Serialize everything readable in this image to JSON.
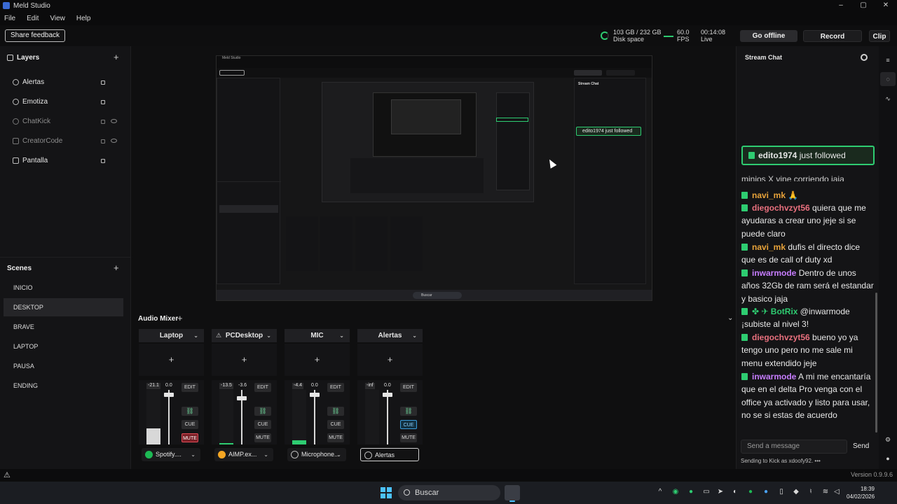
{
  "window": {
    "title": "Meld Studio",
    "controls": [
      "–",
      "▢",
      "✕"
    ]
  },
  "menu": [
    "File",
    "Edit",
    "View",
    "Help"
  ],
  "toolbar": {
    "feedback_label": "Share feedback",
    "disk_value": "103 GB / 232 GB",
    "disk_label": "Disk space",
    "fps_value": "60.0",
    "fps_label": "FPS",
    "live_time": "00:14:08",
    "live_label": "Live",
    "go_offline": "Go offline",
    "record": "Record",
    "clip": "Clip"
  },
  "layers": {
    "title": "Layers",
    "items": [
      {
        "label": "Alertas",
        "dim": false
      },
      {
        "label": "Emotiza",
        "dim": false
      },
      {
        "label": "ChatKick",
        "dim": true
      },
      {
        "label": "CreatorCode",
        "dim": true
      },
      {
        "label": "Pantalla",
        "dim": false
      }
    ]
  },
  "scenes": {
    "title": "Scenes",
    "items": [
      "INICIO",
      "DESKTOP",
      "BRAVE",
      "LAPTOP",
      "PAUSA",
      "ENDING"
    ],
    "active": "DESKTOP"
  },
  "mixer": {
    "title": "Audio Mixer",
    "channels": [
      {
        "name": "Laptop",
        "meter_db": "-21.1",
        "fader_db": "0.0",
        "level": 0.3,
        "fader": 0.95,
        "muted": true,
        "cue": false,
        "source": "Spotify....",
        "source_color": "#1db954",
        "warn": false,
        "meter_color": "#d8d8d8"
      },
      {
        "name": "PCDesktop",
        "meter_db": "-13.5",
        "fader_db": "-3.6",
        "level": 0.02,
        "fader": 0.88,
        "muted": false,
        "cue": false,
        "source": "AIMP.ex...",
        "source_color": "#f5a623",
        "warn": true,
        "meter_color": "#2ecc71"
      },
      {
        "name": "MIC",
        "meter_db": "-4.4",
        "fader_db": "0.0",
        "level": 0.08,
        "fader": 0.95,
        "muted": false,
        "cue": false,
        "source": "Microphone...",
        "source_color": "",
        "warn": false,
        "meter_color": "#2ecc71"
      },
      {
        "name": "Alertas",
        "meter_db": "-inf",
        "fader_db": "0.0",
        "level": 0.0,
        "fader": 0.95,
        "muted": false,
        "cue": true,
        "source": "Alertas",
        "source_color": "",
        "warn": false,
        "meter_color": "#2ecc71"
      }
    ],
    "btn_edit": "EDIT",
    "btn_cue": "CUE",
    "btn_mute": "MUTE"
  },
  "chat": {
    "title": "Stream Chat",
    "follow": {
      "user": "edito1974",
      "text": "just followed"
    },
    "partial_top": "minios X vine corriendo jaja",
    "messages": [
      {
        "user": "navi_mk",
        "color": "#e8a33a",
        "text": "🙏",
        "extra": ""
      },
      {
        "user": "diegochvzyt56",
        "color": "#e9707e",
        "text": "quiera que me ayudaras a crear uno jeje si se puede claro",
        "extra": ""
      },
      {
        "user": "navi_mk",
        "color": "#e8a33a",
        "text": "dufis el directo dice que es de call of duty xd",
        "extra": ""
      },
      {
        "user": "inwarmode",
        "color": "#c77dff",
        "text": "Dentro de unos años 32Gb de ram será el estandar y basico jaja",
        "extra": ""
      },
      {
        "user": "BotRix",
        "color": "#2ecc71",
        "text": "@inwarmode ¡subiste al nivel 3!",
        "extra": "✤ ✈ "
      },
      {
        "user": "diegochvzyt56",
        "color": "#e9707e",
        "text": "bueno yo ya tengo uno pero no me sale mi menu extendido jeje",
        "extra": ""
      },
      {
        "user": "inwarmode",
        "color": "#c77dff",
        "text": "A mi me encantaría que en el delta Pro venga con el office ya activado y listo para usar, no se si estas de acuerdo",
        "extra": ""
      }
    ],
    "input_placeholder": "Send a message",
    "send_label": "Send",
    "footer": "Sending to Kick as xdoofy92."
  },
  "preview": {
    "inner_title": "Meld Studio",
    "inner_follow": "edito1974 just followed",
    "inner_chat_title": "Stream Chat",
    "inner_search": "Buscar"
  },
  "status": {
    "version": "Version 0.9.9.6"
  },
  "taskbar": {
    "search": "Buscar",
    "time": "18:39",
    "date": "04/02/2026"
  },
  "colors": {
    "accent_green": "#2ecc71",
    "mute_red": "#e04b57",
    "cue_blue": "#3a9ad9"
  }
}
